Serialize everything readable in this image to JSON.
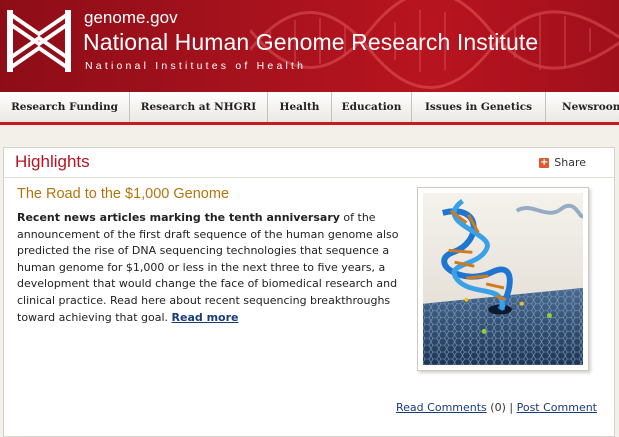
{
  "header": {
    "site_url": "genome.gov",
    "site_title": "National Human Genome Research Institute",
    "site_subtitle": "National Institutes of Health",
    "logo_icon": "nhgri-logo-icon",
    "background_color": "#a6121d"
  },
  "nav": {
    "items": [
      {
        "label": "Research Funding"
      },
      {
        "label": "Research at NHGRI"
      },
      {
        "label": "Health"
      },
      {
        "label": "Education"
      },
      {
        "label": "Issues in Genetics"
      },
      {
        "label": "Newsroom"
      }
    ]
  },
  "highlights": {
    "title": "Highlights",
    "share_label": "Share",
    "share_icon": "share-plus-icon",
    "article": {
      "title": "The Road to the $1,000 Genome",
      "lead_bold": "Recent news articles marking the tenth anniversary",
      "body": " of the announcement of the first draft sequence of the human genome also predicted the rise of DNA sequencing technologies that sequence a human genome for $1,000 or less in the next three to five years, a development that would change the face of biomedical research and clinical practice. Read here about recent sequencing breakthroughs toward achieving that goal. ",
      "read_more": "Read more",
      "image_icon": "dna-nanopore-illustration"
    },
    "comments": {
      "read_label": "Read Comments",
      "count": "(0)",
      "separator": "|",
      "post_label": "Post Comment"
    }
  },
  "colors": {
    "accent_red": "#b8141f",
    "article_title": "#b2750e",
    "link": "#1a3b7a"
  }
}
